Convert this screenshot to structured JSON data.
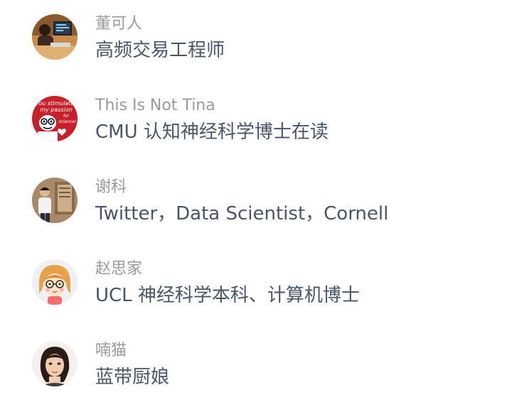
{
  "people": [
    {
      "name": "董可人",
      "desc": "高频交易工程师",
      "avatar_icon": "photo-avatar-computer-desk"
    },
    {
      "name": "This Is Not Tina",
      "desc": "CMU 认知神经科学博士在读",
      "avatar_icon": "cartoon-avatar-red",
      "avatar_text": [
        "you stimulate",
        "my passion",
        "for",
        "science!"
      ]
    },
    {
      "name": "谢科",
      "desc": "Twitter，Data Scientist，Cornell",
      "avatar_icon": "photo-avatar-man-standing"
    },
    {
      "name": "赵思家",
      "desc": "UCL 神经科学本科、计算机博士",
      "avatar_icon": "cartoon-avatar-girl-glasses"
    },
    {
      "name": "喃猫",
      "desc": "蓝带厨娘",
      "avatar_icon": "photo-avatar-woman-portrait"
    }
  ],
  "colors": {
    "name_text": "#9a9a9a",
    "desc_text": "#4a5568",
    "background": "#ffffff"
  }
}
